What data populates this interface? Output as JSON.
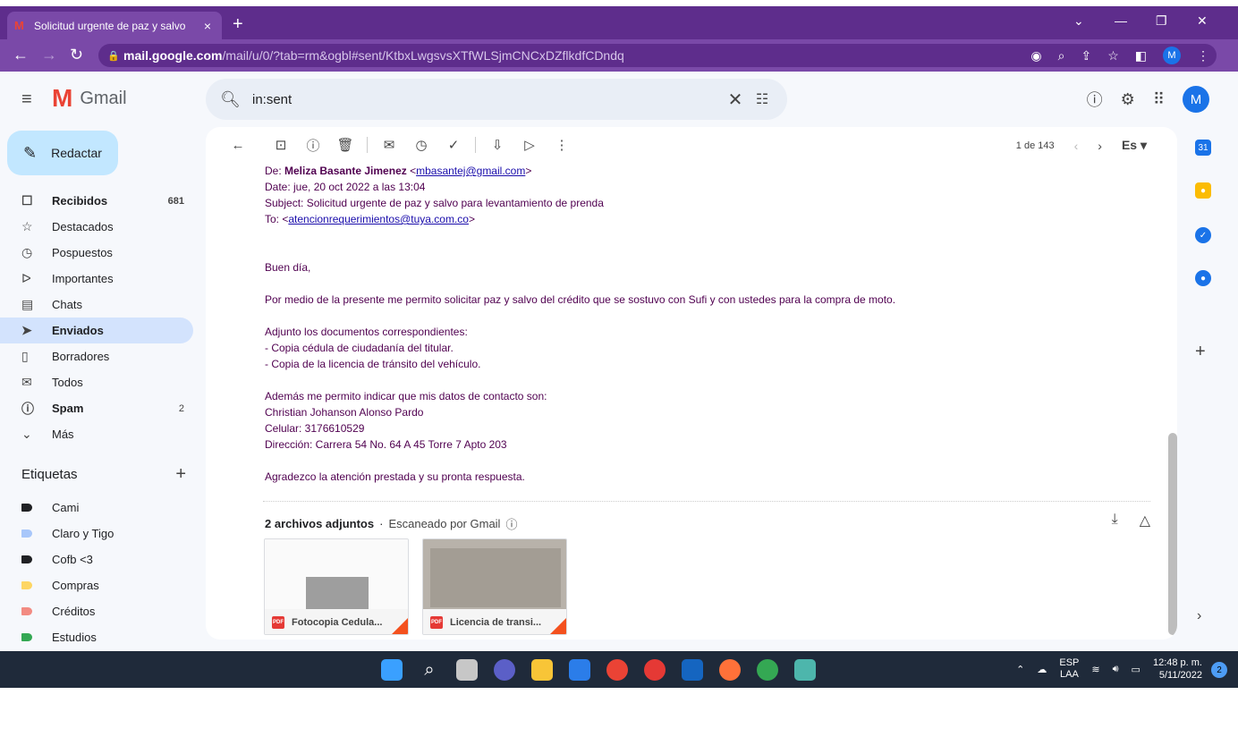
{
  "browser": {
    "tab_title": "Solicitud urgente de paz y salvo",
    "tab_close": "×",
    "new_tab": "+",
    "url_host": "mail.google.com",
    "url_path": "/mail/u/0/?tab=rm&ogbl#sent/KtbxLwgsvsXTfWLSjmCNCxDZflkdfCDndq",
    "profile_initial": "M"
  },
  "gmail": {
    "brand": "Gmail",
    "search_value": "in:sent",
    "compose_label": "Redactar",
    "profile_initial": "M",
    "nav": [
      {
        "label": "Recibidos",
        "count": "681",
        "icon": "inbox-icon"
      },
      {
        "label": "Destacados",
        "count": "",
        "icon": "star-icon"
      },
      {
        "label": "Pospuestos",
        "count": "",
        "icon": "clock-icon"
      },
      {
        "label": "Importantes",
        "count": "",
        "icon": "important-icon"
      },
      {
        "label": "Chats",
        "count": "",
        "icon": "chat-icon"
      },
      {
        "label": "Enviados",
        "count": "",
        "icon": "send-icon"
      },
      {
        "label": "Borradores",
        "count": "",
        "icon": "draft-icon"
      },
      {
        "label": "Todos",
        "count": "",
        "icon": "all-mail-icon"
      },
      {
        "label": "Spam",
        "count": "2",
        "icon": "spam-icon"
      },
      {
        "label": "Más",
        "count": "",
        "icon": "chevron-down-icon"
      }
    ],
    "labels_title": "Etiquetas",
    "labels": [
      {
        "label": "Cami",
        "color": "#202124"
      },
      {
        "label": "Claro y Tigo",
        "color": "#a8c7fa"
      },
      {
        "label": "Cofb <3",
        "color": "#202124"
      },
      {
        "label": "Compras",
        "color": "#fdd663"
      },
      {
        "label": "Créditos",
        "color": "#f28b82"
      },
      {
        "label": "Estudios",
        "color": "#34a853"
      }
    ],
    "pager": {
      "text": "1 de 143",
      "lang": "Es"
    },
    "email": {
      "from_prefix": "De: ",
      "from_name": "Meliza Basante Jimenez",
      "from_email": "mbasantej@gmail.com",
      "date": "Date: jue, 20 oct 2022 a las 13:04",
      "subject": "Subject: Solicitud urgente de paz y salvo para levantamiento de prenda",
      "to_prefix": "To: ",
      "to_email": "atencionrequerimientos@tuya.com.co",
      "greeting": "Buen día,",
      "p1": "Por medio de la presente me permito solicitar paz y salvo del crédito que se sostuvo con Sufi y con ustedes para la compra de moto.",
      "docs_intro": "Adjunto los documentos correspondientes:",
      "doc1": "- Copia cédula de ciudadanía del titular.",
      "doc2": "- Copia de la licencia de tránsito del vehículo.",
      "contact_intro": "Además me permito indicar que mis datos de contacto son:",
      "contact_name": "Christian Johanson Alonso Pardo",
      "contact_phone": "Celular: 3176610529",
      "contact_address": "Dirección: Carrera 54 No. 64 A 45 Torre 7 Apto 203",
      "closing": "Agradezco la atención prestada y su pronta respuesta."
    },
    "attachments_title": "2 archivos adjuntos",
    "attachments_scan": "Escaneado por Gmail",
    "attachments": [
      {
        "name": "Fotocopia Cedula...",
        "type": "PDF"
      },
      {
        "name": "Licencia de transi...",
        "type": "PDF"
      }
    ]
  },
  "taskbar": {
    "lang_top": "ESP",
    "lang_bottom": "LAA",
    "time": "12:48 p. m.",
    "date": "5/11/2022",
    "notifications": "2"
  }
}
